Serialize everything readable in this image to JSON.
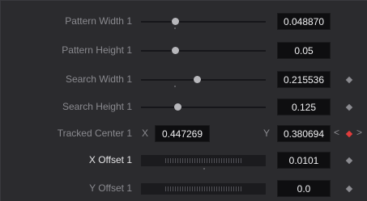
{
  "params": {
    "pattern_width": {
      "label": "Pattern Width 1",
      "value": "0.048870",
      "slider_fraction": 0.27
    },
    "pattern_height": {
      "label": "Pattern Height 1",
      "value": "0.05",
      "slider_fraction": 0.27
    },
    "search_width": {
      "label": "Search Width 1",
      "value": "0.215536",
      "slider_fraction": 0.45
    },
    "search_height": {
      "label": "Search Height 1",
      "value": "0.125",
      "slider_fraction": 0.29
    },
    "tracked_center": {
      "label": "Tracked Center 1",
      "x_label": "X",
      "x_value": "0.447269",
      "y_label": "Y",
      "y_value": "0.380694",
      "prev_symbol": "<",
      "next_symbol": ">"
    },
    "x_offset": {
      "label": "X Offset 1",
      "value": "0.0101"
    },
    "y_offset": {
      "label": "Y Offset 1",
      "value": "0.0"
    }
  },
  "colors": {
    "background": "#2b2b2e",
    "field_bg": "#0e0e10",
    "keyframe": "#8b8b90",
    "keyframe_active": "#e03c3c"
  },
  "icons": [
    "keyframe-diamond-icon",
    "keyframe-active-icon",
    "prev-keyframe-icon",
    "next-keyframe-icon"
  ]
}
